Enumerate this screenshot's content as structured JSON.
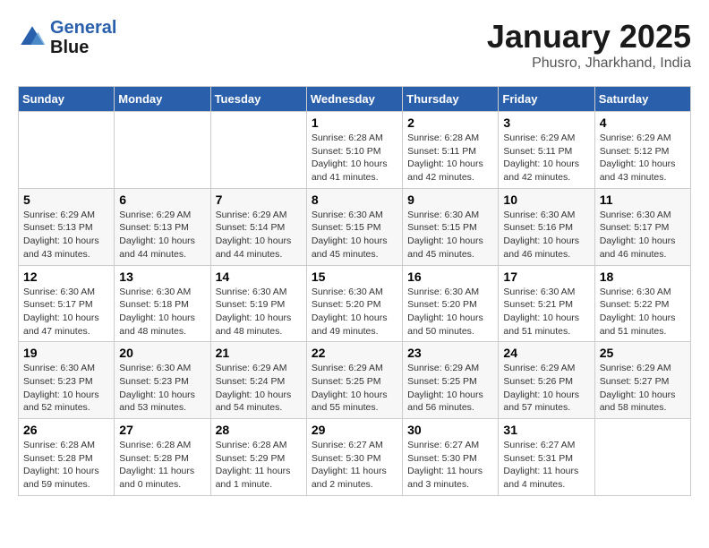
{
  "header": {
    "logo_line1": "General",
    "logo_line2": "Blue",
    "month": "January 2025",
    "location": "Phusro, Jharkhand, India"
  },
  "weekdays": [
    "Sunday",
    "Monday",
    "Tuesday",
    "Wednesday",
    "Thursday",
    "Friday",
    "Saturday"
  ],
  "weeks": [
    [
      {
        "day": "",
        "info": ""
      },
      {
        "day": "",
        "info": ""
      },
      {
        "day": "",
        "info": ""
      },
      {
        "day": "1",
        "info": "Sunrise: 6:28 AM\nSunset: 5:10 PM\nDaylight: 10 hours\nand 41 minutes."
      },
      {
        "day": "2",
        "info": "Sunrise: 6:28 AM\nSunset: 5:11 PM\nDaylight: 10 hours\nand 42 minutes."
      },
      {
        "day": "3",
        "info": "Sunrise: 6:29 AM\nSunset: 5:11 PM\nDaylight: 10 hours\nand 42 minutes."
      },
      {
        "day": "4",
        "info": "Sunrise: 6:29 AM\nSunset: 5:12 PM\nDaylight: 10 hours\nand 43 minutes."
      }
    ],
    [
      {
        "day": "5",
        "info": "Sunrise: 6:29 AM\nSunset: 5:13 PM\nDaylight: 10 hours\nand 43 minutes."
      },
      {
        "day": "6",
        "info": "Sunrise: 6:29 AM\nSunset: 5:13 PM\nDaylight: 10 hours\nand 44 minutes."
      },
      {
        "day": "7",
        "info": "Sunrise: 6:29 AM\nSunset: 5:14 PM\nDaylight: 10 hours\nand 44 minutes."
      },
      {
        "day": "8",
        "info": "Sunrise: 6:30 AM\nSunset: 5:15 PM\nDaylight: 10 hours\nand 45 minutes."
      },
      {
        "day": "9",
        "info": "Sunrise: 6:30 AM\nSunset: 5:15 PM\nDaylight: 10 hours\nand 45 minutes."
      },
      {
        "day": "10",
        "info": "Sunrise: 6:30 AM\nSunset: 5:16 PM\nDaylight: 10 hours\nand 46 minutes."
      },
      {
        "day": "11",
        "info": "Sunrise: 6:30 AM\nSunset: 5:17 PM\nDaylight: 10 hours\nand 46 minutes."
      }
    ],
    [
      {
        "day": "12",
        "info": "Sunrise: 6:30 AM\nSunset: 5:17 PM\nDaylight: 10 hours\nand 47 minutes."
      },
      {
        "day": "13",
        "info": "Sunrise: 6:30 AM\nSunset: 5:18 PM\nDaylight: 10 hours\nand 48 minutes."
      },
      {
        "day": "14",
        "info": "Sunrise: 6:30 AM\nSunset: 5:19 PM\nDaylight: 10 hours\nand 48 minutes."
      },
      {
        "day": "15",
        "info": "Sunrise: 6:30 AM\nSunset: 5:20 PM\nDaylight: 10 hours\nand 49 minutes."
      },
      {
        "day": "16",
        "info": "Sunrise: 6:30 AM\nSunset: 5:20 PM\nDaylight: 10 hours\nand 50 minutes."
      },
      {
        "day": "17",
        "info": "Sunrise: 6:30 AM\nSunset: 5:21 PM\nDaylight: 10 hours\nand 51 minutes."
      },
      {
        "day": "18",
        "info": "Sunrise: 6:30 AM\nSunset: 5:22 PM\nDaylight: 10 hours\nand 51 minutes."
      }
    ],
    [
      {
        "day": "19",
        "info": "Sunrise: 6:30 AM\nSunset: 5:23 PM\nDaylight: 10 hours\nand 52 minutes."
      },
      {
        "day": "20",
        "info": "Sunrise: 6:30 AM\nSunset: 5:23 PM\nDaylight: 10 hours\nand 53 minutes."
      },
      {
        "day": "21",
        "info": "Sunrise: 6:29 AM\nSunset: 5:24 PM\nDaylight: 10 hours\nand 54 minutes."
      },
      {
        "day": "22",
        "info": "Sunrise: 6:29 AM\nSunset: 5:25 PM\nDaylight: 10 hours\nand 55 minutes."
      },
      {
        "day": "23",
        "info": "Sunrise: 6:29 AM\nSunset: 5:25 PM\nDaylight: 10 hours\nand 56 minutes."
      },
      {
        "day": "24",
        "info": "Sunrise: 6:29 AM\nSunset: 5:26 PM\nDaylight: 10 hours\nand 57 minutes."
      },
      {
        "day": "25",
        "info": "Sunrise: 6:29 AM\nSunset: 5:27 PM\nDaylight: 10 hours\nand 58 minutes."
      }
    ],
    [
      {
        "day": "26",
        "info": "Sunrise: 6:28 AM\nSunset: 5:28 PM\nDaylight: 10 hours\nand 59 minutes."
      },
      {
        "day": "27",
        "info": "Sunrise: 6:28 AM\nSunset: 5:28 PM\nDaylight: 11 hours\nand 0 minutes."
      },
      {
        "day": "28",
        "info": "Sunrise: 6:28 AM\nSunset: 5:29 PM\nDaylight: 11 hours\nand 1 minute."
      },
      {
        "day": "29",
        "info": "Sunrise: 6:27 AM\nSunset: 5:30 PM\nDaylight: 11 hours\nand 2 minutes."
      },
      {
        "day": "30",
        "info": "Sunrise: 6:27 AM\nSunset: 5:30 PM\nDaylight: 11 hours\nand 3 minutes."
      },
      {
        "day": "31",
        "info": "Sunrise: 6:27 AM\nSunset: 5:31 PM\nDaylight: 11 hours\nand 4 minutes."
      },
      {
        "day": "",
        "info": ""
      }
    ]
  ]
}
